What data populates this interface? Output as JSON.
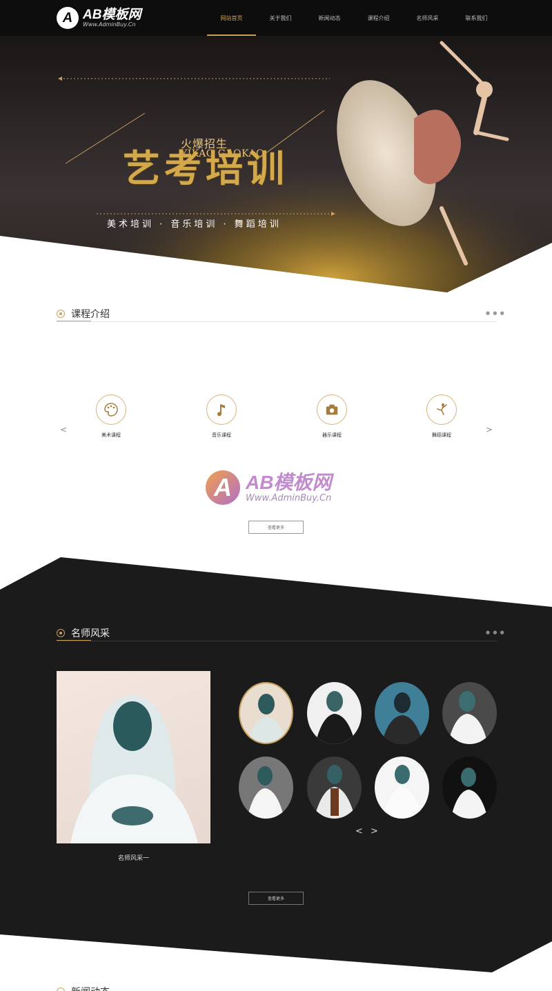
{
  "header": {
    "logo_mark": "A",
    "logo_title": "AB模板网",
    "logo_url": "Www.AdminBuy.Cn",
    "nav": [
      {
        "label": "网站首页",
        "active": true
      },
      {
        "label": "关于我们",
        "active": false
      },
      {
        "label": "新闻动态",
        "active": false
      },
      {
        "label": "课程介绍",
        "active": false
      },
      {
        "label": "名师风采",
        "active": false
      },
      {
        "label": "联系我们",
        "active": false
      }
    ]
  },
  "banner": {
    "small_title": "火爆招生",
    "english_title": "YIKAO GAOKAO",
    "big_title": "艺考培训",
    "subtitle": "美术培训 · 音乐培训 · 舞蹈培训"
  },
  "courses_section": {
    "title": "课程介绍",
    "dots": "● ● ●",
    "prev": "<",
    "next": ">",
    "items": [
      {
        "label": "美术课程",
        "icon": "palette-icon"
      },
      {
        "label": "音乐课程",
        "icon": "music-note-icon"
      },
      {
        "label": "器乐课程",
        "icon": "camera-icon"
      },
      {
        "label": "舞蹈课程",
        "icon": "dancer-icon"
      }
    ],
    "more": "查看更多"
  },
  "watermark": {
    "mark": "A",
    "title": "AB模板网",
    "url": "Www.AdminBuy.Cn"
  },
  "teachers_section": {
    "title": "名师风采",
    "dots": "● ● ●",
    "featured_caption": "名师风采一",
    "prev": "<",
    "next": ">",
    "more": "查看更多"
  },
  "news_section": {
    "title": "新闻动态"
  },
  "colors": {
    "accent": "#c8a060",
    "header_bg": "#0e0d0d",
    "dark_bg": "#1c1b1b"
  }
}
